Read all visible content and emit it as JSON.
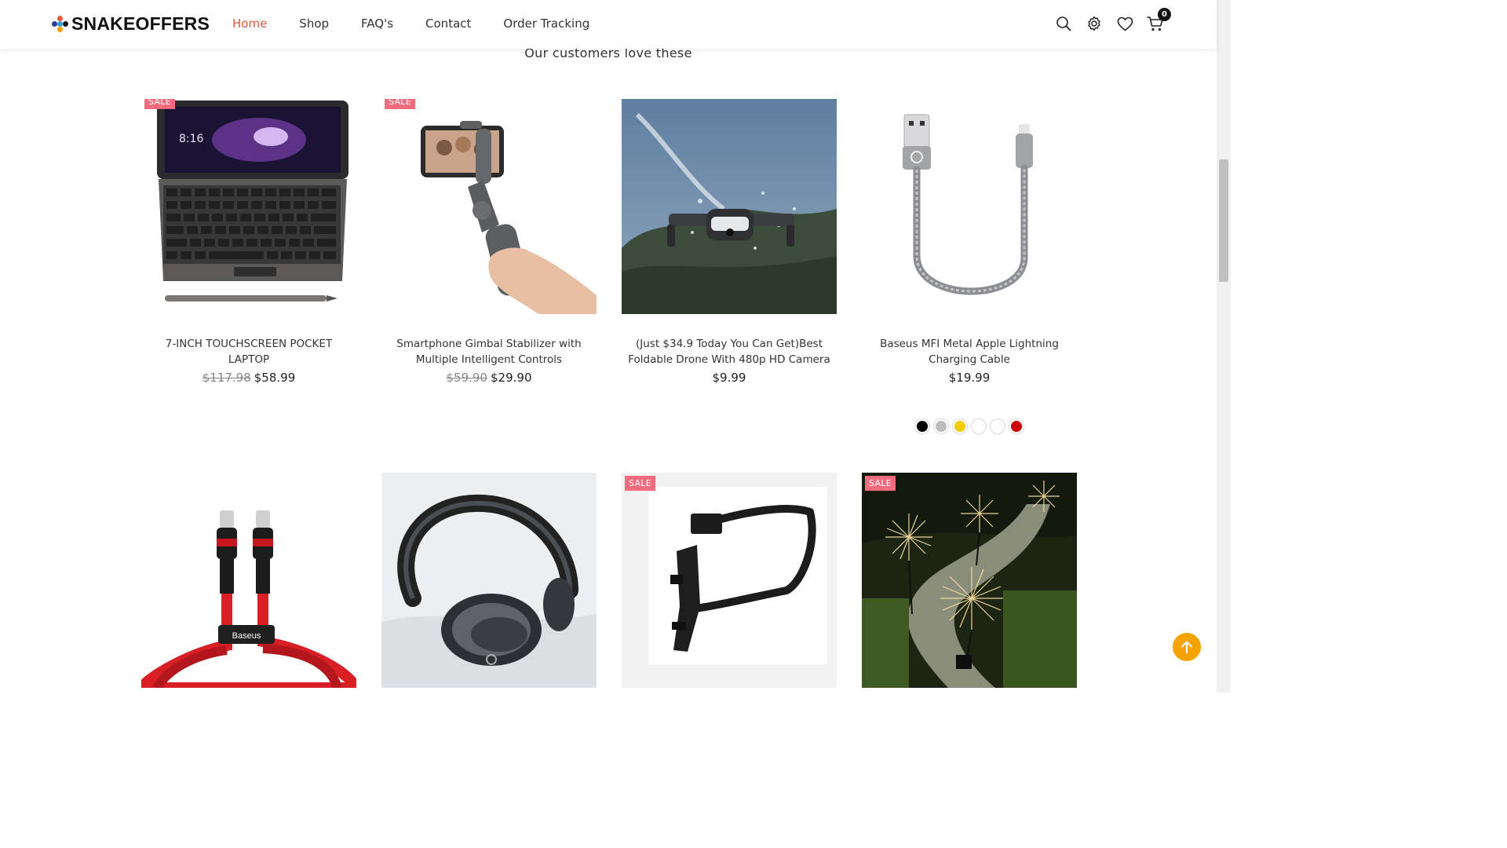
{
  "brand": {
    "name": "SNAKEOFFERS"
  },
  "nav": {
    "items": [
      {
        "label": "Home",
        "active": true
      },
      {
        "label": "Shop",
        "active": false
      },
      {
        "label": "FAQ's",
        "active": false
      },
      {
        "label": "Contact",
        "active": false
      },
      {
        "label": "Order Tracking",
        "active": false
      }
    ],
    "active_color": "#e2593b"
  },
  "header_icons": [
    "search-icon",
    "gear-icon",
    "heart-icon",
    "cart-icon"
  ],
  "cart": {
    "count": "0"
  },
  "section": {
    "title": "Our customers love these"
  },
  "sale_label": "SALE",
  "sale_color": "#f26c7e",
  "products": [
    {
      "name": "7-INCH TOUCHSCREEN POCKET LAPTOP",
      "old_price": "$117.98",
      "price": "$58.99",
      "sale": true
    },
    {
      "name": "Smartphone Gimbal Stabilizer with Multiple Intelligent Controls",
      "old_price": "$59.90",
      "price": "$29.90",
      "sale": true
    },
    {
      "name": "(Just $34.9 Today You Can Get)Best Foldable Drone With 480p HD Camera",
      "old_price": "",
      "price": "$9.99",
      "sale": false
    },
    {
      "name": "Baseus MFI Metal Apple Lightning Charging Cable",
      "old_price": "",
      "price": "$19.99",
      "sale": false,
      "swatches": [
        "#000000",
        "#bdbdbd",
        "#f5cc00",
        "#ffffff",
        "#ffffff",
        "#cc0000"
      ]
    },
    {
      "name": "",
      "sale": false
    },
    {
      "name": "",
      "sale": false
    },
    {
      "name": "",
      "sale": true
    },
    {
      "name": "",
      "sale": true
    }
  ],
  "back_to_top": {
    "icon": "arrow-up-icon",
    "color": "#f5a300"
  }
}
